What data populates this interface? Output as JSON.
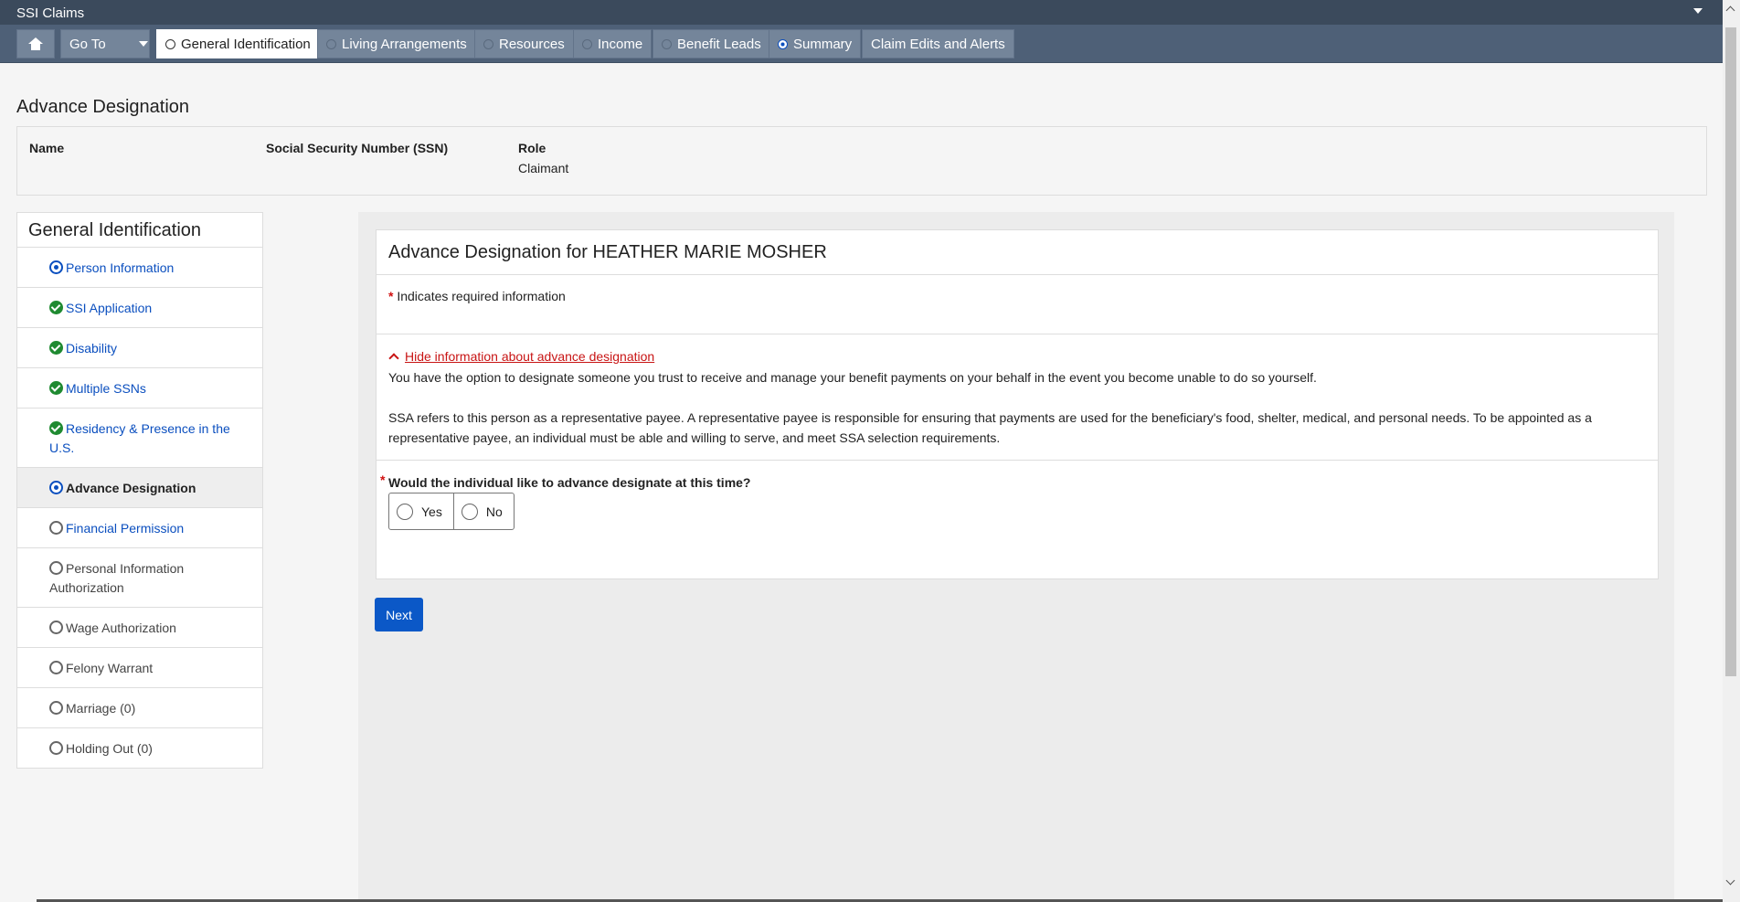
{
  "app": {
    "title": "SSI Claims"
  },
  "nav": {
    "goto_label": "Go To",
    "tabs": [
      {
        "label": "General Identification",
        "state": "active"
      },
      {
        "label": "Living Arrangements",
        "state": "empty"
      },
      {
        "label": "Resources",
        "state": "empty"
      },
      {
        "label": "Income",
        "state": "empty"
      },
      {
        "label": "Benefit Leads",
        "state": "empty"
      },
      {
        "label": "Summary",
        "state": "current"
      },
      {
        "label": "Claim Edits and Alerts",
        "state": "none"
      }
    ]
  },
  "page": {
    "title": "Advance Designation"
  },
  "info": {
    "name_label": "Name",
    "ssn_label": "Social Security Number (SSN)",
    "role_label": "Role",
    "role_value": "Claimant"
  },
  "sidebar": {
    "title": "General Identification",
    "items": [
      {
        "label": "Person Information",
        "status": "in-progress",
        "link": true
      },
      {
        "label": "SSI Application",
        "status": "complete",
        "link": true
      },
      {
        "label": "Disability",
        "status": "complete",
        "link": true
      },
      {
        "label": "Multiple SSNs",
        "status": "complete",
        "link": true
      },
      {
        "label": "Residency & Presence in the U.S.",
        "status": "complete",
        "link": true
      },
      {
        "label": "Advance Designation",
        "status": "in-progress",
        "link": false,
        "current": true
      },
      {
        "label": "Financial Permission",
        "status": "not-started",
        "link": true
      },
      {
        "label": "Personal Information Authorization",
        "status": "not-started",
        "link": false
      },
      {
        "label": "Wage Authorization",
        "status": "not-started",
        "link": false
      },
      {
        "label": "Felony Warrant",
        "status": "not-started",
        "link": false
      },
      {
        "label": "Marriage (0)",
        "status": "not-started",
        "link": false
      },
      {
        "label": "Holding Out (0)",
        "status": "not-started",
        "link": false
      }
    ]
  },
  "form": {
    "title": "Advance Designation for HEATHER MARIE MOSHER",
    "required_marker": "*",
    "required_note": "Indicates required information",
    "hide_link": "Hide information about advance designation",
    "para1": "You have the option to designate someone you trust to receive and manage your benefit payments on your behalf in the event you become unable to do so yourself.",
    "para2": "SSA refers to this person as a representative payee. A representative payee is responsible for ensuring that payments are used for the beneficiary's food, shelter, medical, and personal needs. To be appointed as a representative payee, an individual must be able and willing to serve, and meet SSA selection requirements.",
    "question": "Would the individual like to advance designate at this time?",
    "options": [
      "Yes",
      "No"
    ],
    "next_label": "Next"
  },
  "colors": {
    "header": "#3b4a5c",
    "nav": "#4e6077",
    "accent": "#0b58c7",
    "complete": "#1f8a31",
    "required": "#d01010"
  }
}
